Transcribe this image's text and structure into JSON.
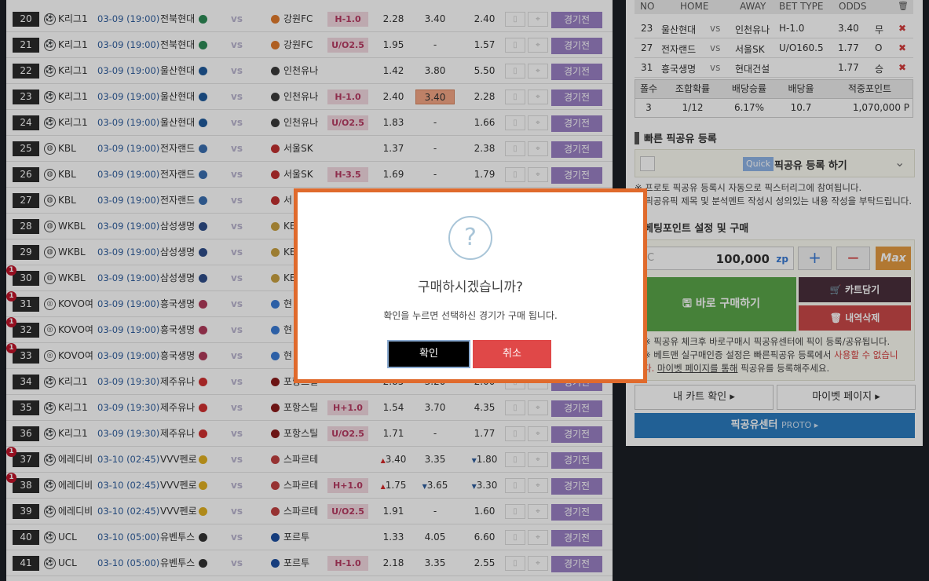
{
  "colors": {
    "accent": "#9a81c4",
    "modal_border": "#e06a2c",
    "confirm_bg": "#000000",
    "cancel_bg": "#e04848",
    "bettype_bg": "#f2d9e1",
    "bettype_text": "#b73a62",
    "datetime": "#2f5e9e"
  },
  "matches": [
    {
      "no": "20",
      "badge": "",
      "sport": "soccer",
      "league": "K리그1",
      "dt": "03-09 (19:00)",
      "home": "전북현대",
      "vs": "vs",
      "away": "강원FC",
      "bettype": "H-1.0",
      "o1": "2.28",
      "o1d": "",
      "o2": "3.40",
      "o2d": "",
      "o2sel": false,
      "o3": "2.40",
      "o3d": "",
      "btn": "경기전"
    },
    {
      "no": "21",
      "badge": "",
      "sport": "soccer",
      "league": "K리그1",
      "dt": "03-09 (19:00)",
      "home": "전북현대",
      "vs": "vs",
      "away": "강원FC",
      "bettype": "U/O2.5",
      "o1": "1.95",
      "o1d": "",
      "o2": "-",
      "o2d": "",
      "o2sel": false,
      "o3": "1.57",
      "o3d": "",
      "btn": "경기전"
    },
    {
      "no": "22",
      "badge": "",
      "sport": "soccer",
      "league": "K리그1",
      "dt": "03-09 (19:00)",
      "home": "울산현대",
      "vs": "vs",
      "away": "인천유나",
      "bettype": "",
      "o1": "1.42",
      "o1d": "",
      "o2": "3.80",
      "o2d": "",
      "o2sel": false,
      "o3": "5.50",
      "o3d": "",
      "btn": "경기전"
    },
    {
      "no": "23",
      "badge": "",
      "sport": "soccer",
      "league": "K리그1",
      "dt": "03-09 (19:00)",
      "home": "울산현대",
      "vs": "vs",
      "away": "인천유나",
      "bettype": "H-1.0",
      "o1": "2.40",
      "o1d": "",
      "o2": "3.40",
      "o2d": "",
      "o2sel": true,
      "o3": "2.28",
      "o3d": "",
      "btn": "경기전"
    },
    {
      "no": "24",
      "badge": "",
      "sport": "soccer",
      "league": "K리그1",
      "dt": "03-09 (19:00)",
      "home": "울산현대",
      "vs": "vs",
      "away": "인천유나",
      "bettype": "U/O2.5",
      "o1": "1.83",
      "o1d": "",
      "o2": "-",
      "o2d": "",
      "o2sel": false,
      "o3": "1.66",
      "o3d": "",
      "btn": "경기전"
    },
    {
      "no": "25",
      "badge": "",
      "sport": "basketball",
      "league": "KBL",
      "dt": "03-09 (19:00)",
      "home": "전자랜드",
      "vs": "vs",
      "away": "서울SK",
      "bettype": "",
      "o1": "1.37",
      "o1d": "",
      "o2": "-",
      "o2d": "",
      "o2sel": false,
      "o3": "2.38",
      "o3d": "",
      "btn": "경기전"
    },
    {
      "no": "26",
      "badge": "",
      "sport": "basketball",
      "league": "KBL",
      "dt": "03-09 (19:00)",
      "home": "전자랜드",
      "vs": "vs",
      "away": "서울SK",
      "bettype": "H-3.5",
      "o1": "1.69",
      "o1d": "",
      "o2": "-",
      "o2d": "",
      "o2sel": false,
      "o3": "1.79",
      "o3d": "",
      "btn": "경기전"
    },
    {
      "no": "27",
      "badge": "",
      "sport": "basketball",
      "league": "KBL",
      "dt": "03-09 (19:00)",
      "home": "전자랜드",
      "vs": "vs",
      "away": "서",
      "bettype": "",
      "o1": "",
      "o1d": "",
      "o2": "",
      "o2d": "",
      "o2sel": false,
      "o3": "",
      "o3d": "",
      "btn": ""
    },
    {
      "no": "28",
      "badge": "",
      "sport": "basketball",
      "league": "WKBL",
      "dt": "03-09 (19:00)",
      "home": "삼성생명",
      "vs": "vs",
      "away": "KE",
      "bettype": "",
      "o1": "",
      "o1d": "",
      "o2": "",
      "o2d": "",
      "o2sel": false,
      "o3": "",
      "o3d": "",
      "btn": ""
    },
    {
      "no": "29",
      "badge": "",
      "sport": "basketball",
      "league": "WKBL",
      "dt": "03-09 (19:00)",
      "home": "삼성생명",
      "vs": "vs",
      "away": "KE",
      "bettype": "",
      "o1": "",
      "o1d": "",
      "o2": "",
      "o2d": "",
      "o2sel": false,
      "o3": "",
      "o3d": "",
      "btn": ""
    },
    {
      "no": "30",
      "badge": "1",
      "sport": "basketball",
      "league": "WKBL",
      "dt": "03-09 (19:00)",
      "home": "삼성생명",
      "vs": "vs",
      "away": "KE",
      "bettype": "",
      "o1": "",
      "o1d": "",
      "o2": "",
      "o2d": "",
      "o2sel": false,
      "o3": "",
      "o3d": "",
      "btn": ""
    },
    {
      "no": "31",
      "badge": "1",
      "sport": "volleyball",
      "league": "KOVO여",
      "dt": "03-09 (19:00)",
      "home": "흥국생명",
      "vs": "vs",
      "away": "현",
      "bettype": "",
      "o1": "",
      "o1d": "",
      "o2": "",
      "o2d": "",
      "o2sel": false,
      "o3": "",
      "o3d": "",
      "btn": ""
    },
    {
      "no": "32",
      "badge": "1",
      "sport": "volleyball",
      "league": "KOVO여",
      "dt": "03-09 (19:00)",
      "home": "흥국생명",
      "vs": "vs",
      "away": "현",
      "bettype": "",
      "o1": "",
      "o1d": "",
      "o2": "",
      "o2d": "",
      "o2sel": false,
      "o3": "",
      "o3d": "",
      "btn": ""
    },
    {
      "no": "33",
      "badge": "1",
      "sport": "volleyball",
      "league": "KOVO여",
      "dt": "03-09 (19:00)",
      "home": "흥국생명",
      "vs": "vs",
      "away": "현",
      "bettype": "",
      "o1": "",
      "o1d": "",
      "o2": "",
      "o2d": "",
      "o2sel": false,
      "o3": "",
      "o3d": "",
      "btn": ""
    },
    {
      "no": "34",
      "badge": "",
      "sport": "soccer",
      "league": "K리그1",
      "dt": "03-09 (19:30)",
      "home": "제주유나",
      "vs": "vs",
      "away": "포항스틸",
      "bettype": "",
      "o1": "2.85",
      "o1d": "",
      "o2": "3.20",
      "o2d": "",
      "o2sel": false,
      "o3": "2.00",
      "o3d": "",
      "btn": "경기전"
    },
    {
      "no": "35",
      "badge": "",
      "sport": "soccer",
      "league": "K리그1",
      "dt": "03-09 (19:30)",
      "home": "제주유나",
      "vs": "vs",
      "away": "포항스틸",
      "bettype": "H+1.0",
      "o1": "1.54",
      "o1d": "",
      "o2": "3.70",
      "o2d": "",
      "o2sel": false,
      "o3": "4.35",
      "o3d": "",
      "btn": "경기전"
    },
    {
      "no": "36",
      "badge": "",
      "sport": "soccer",
      "league": "K리그1",
      "dt": "03-09 (19:30)",
      "home": "제주유나",
      "vs": "vs",
      "away": "포항스틸",
      "bettype": "U/O2.5",
      "o1": "1.71",
      "o1d": "",
      "o2": "-",
      "o2d": "",
      "o2sel": false,
      "o3": "1.77",
      "o3d": "",
      "btn": "경기전"
    },
    {
      "no": "37",
      "badge": "1",
      "sport": "soccer",
      "league": "에레디비",
      "dt": "03-10 (02:45)",
      "home": "VVV펜로",
      "vs": "vs",
      "away": "스파르테",
      "bettype": "",
      "o1": "3.40",
      "o1d": "up",
      "o2": "3.35",
      "o2d": "",
      "o2sel": false,
      "o3": "1.80",
      "o3d": "down",
      "btn": "경기전"
    },
    {
      "no": "38",
      "badge": "1",
      "sport": "soccer",
      "league": "에레디비",
      "dt": "03-10 (02:45)",
      "home": "VVV펜로",
      "vs": "vs",
      "away": "스파르테",
      "bettype": "H+1.0",
      "o1": "1.75",
      "o1d": "up",
      "o2": "3.65",
      "o2d": "down",
      "o2sel": false,
      "o3": "3.30",
      "o3d": "down",
      "btn": "경기전"
    },
    {
      "no": "39",
      "badge": "",
      "sport": "soccer",
      "league": "에레디비",
      "dt": "03-10 (02:45)",
      "home": "VVV펜로",
      "vs": "vs",
      "away": "스파르테",
      "bettype": "U/O2.5",
      "o1": "1.91",
      "o1d": "",
      "o2": "-",
      "o2d": "",
      "o2sel": false,
      "o3": "1.60",
      "o3d": "",
      "btn": "경기전"
    },
    {
      "no": "40",
      "badge": "",
      "sport": "soccer",
      "league": "UCL",
      "dt": "03-10 (05:00)",
      "home": "유벤투스",
      "vs": "vs",
      "away": "포르투",
      "bettype": "",
      "o1": "1.33",
      "o1d": "",
      "o2": "4.05",
      "o2d": "",
      "o2sel": false,
      "o3": "6.60",
      "o3d": "",
      "btn": "경기전"
    },
    {
      "no": "41",
      "badge": "",
      "sport": "soccer",
      "league": "UCL",
      "dt": "03-10 (05:00)",
      "home": "유벤투스",
      "vs": "vs",
      "away": "포르투",
      "bettype": "H-1.0",
      "o1": "2.18",
      "o1d": "",
      "o2": "3.35",
      "o2d": "",
      "o2sel": false,
      "o3": "2.55",
      "o3d": "",
      "btn": "경기전"
    }
  ],
  "selection": {
    "headers": {
      "no": "NO",
      "home": "HOME",
      "away": "AWAY",
      "bettype": "BET TYPE",
      "odds": "ODDS"
    },
    "rows": [
      {
        "no": "23",
        "home": "울산현대",
        "vs": "vs",
        "away": "인천유나",
        "bettype": "H-1.0",
        "odds": "3.40",
        "pick": "무",
        "x": "✖"
      },
      {
        "no": "27",
        "home": "전자랜드",
        "vs": "vs",
        "away": "서울SK",
        "bettype": "U/O160.5",
        "odds": "1.77",
        "pick": "O",
        "x": "✖"
      },
      {
        "no": "31",
        "home": "흥국생명",
        "vs": "vs",
        "away": "현대건설",
        "bettype": "",
        "odds": "1.77",
        "pick": "승",
        "x": "✖"
      }
    ]
  },
  "summary": {
    "headers": [
      "폴수",
      "조합확률",
      "배당승률",
      "배당율",
      "적중포인트"
    ],
    "values": [
      "3",
      "1/12",
      "6.17%",
      "10.7",
      "1,070,000 P"
    ]
  },
  "quick_share": {
    "title": "빠른 픽공유 등록",
    "badge": "Quick",
    "label": "픽공유 등록 하기"
  },
  "notes": {
    "line1": "※ 프로토 픽공유 등록시 자동으로 픽스터리그에 참여됩니다.",
    "line2": "※ 픽공유픽 제목 및 분석멘트 작성시 성의있는 내용 작성을 부탁드립니다."
  },
  "bet": {
    "section_title": "베팅포인트 설정 및 구매",
    "amount": "100,000",
    "unit": "zp",
    "plus": "+",
    "minus": "−",
    "max": "Max",
    "buy_label": "바로 구매하기",
    "cart_label": "카트담기",
    "delete_label": "내역삭제",
    "note1": "※ 픽공유 체크후 바로구매시 픽공유센터에 픽이 등록/공유됩니다.",
    "note2a": "※ 베트맨 실구매인증 설정은 빠른픽공유 등록에서 ",
    "note2b": "사용할 수 없습니",
    "note3a": "다. ",
    "note3b": "마이벳 페이지를 통해",
    "note3c": " 픽공유를 등록해주세요."
  },
  "nav": {
    "cart_check": "내 카트 확인 ▸",
    "mybet": "마이벳 페이지 ▸",
    "pick_center": "픽공유센터",
    "proto": "PROTO ▸"
  },
  "modal": {
    "icon": "?",
    "title": "구매하시겠습니까?",
    "text": "확인을 누르면 선택하신 경기가 구매 됩니다.",
    "ok": "확인",
    "cancel": "취소"
  }
}
